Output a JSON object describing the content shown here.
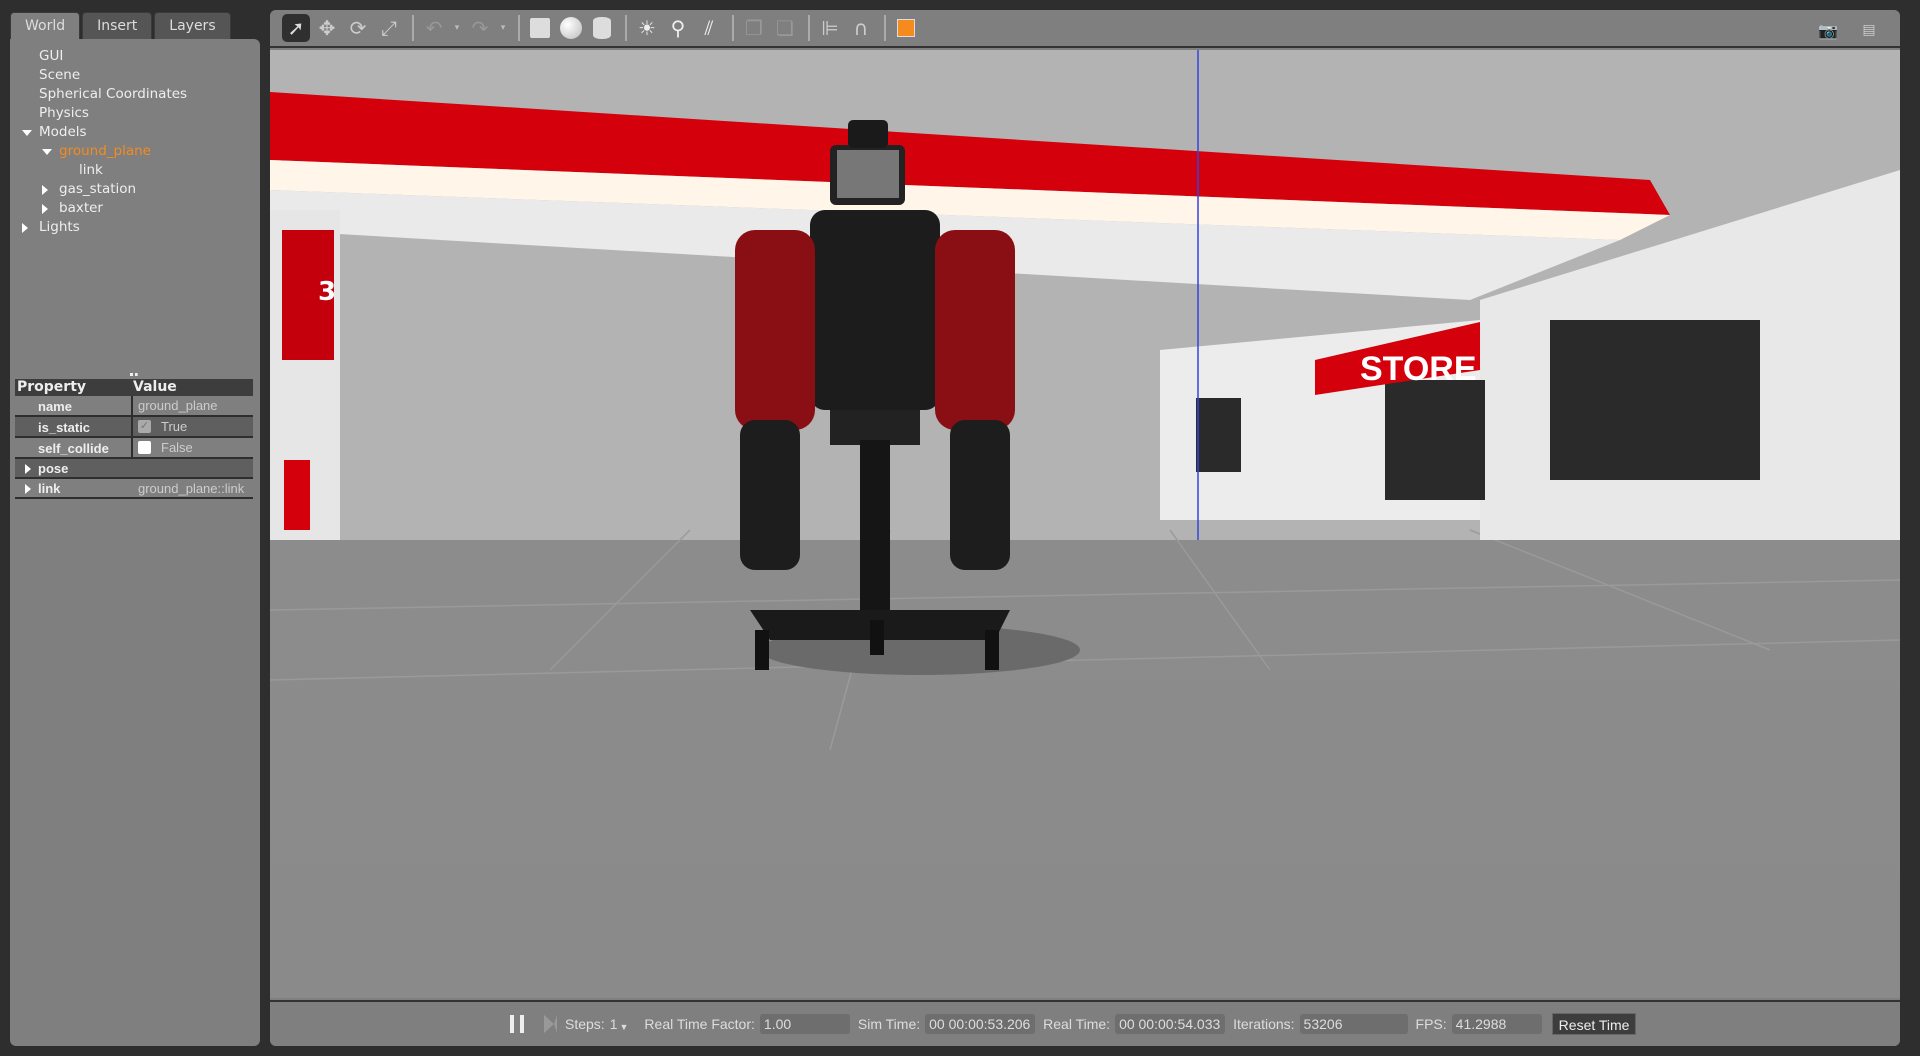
{
  "tabs": [
    "World",
    "Insert",
    "Layers"
  ],
  "tree": [
    {
      "label": "GUI",
      "level": 0,
      "arrow": "none"
    },
    {
      "label": "Scene",
      "level": 0,
      "arrow": "none"
    },
    {
      "label": "Spherical Coordinates",
      "level": 0,
      "arrow": "none"
    },
    {
      "label": "Physics",
      "level": 0,
      "arrow": "none"
    },
    {
      "label": "Models",
      "level": 0,
      "arrow": "down"
    },
    {
      "label": "ground_plane",
      "level": 1,
      "arrow": "down",
      "selected": true
    },
    {
      "label": "link",
      "level": 2,
      "arrow": "none"
    },
    {
      "label": "gas_station",
      "level": 1,
      "arrow": "right"
    },
    {
      "label": "baxter",
      "level": 1,
      "arrow": "right"
    },
    {
      "label": "Lights",
      "level": 0,
      "arrow": "right"
    }
  ],
  "properties": {
    "header": {
      "property": "Property",
      "value": "Value"
    },
    "rows": [
      {
        "key": "name",
        "value": "ground_plane"
      },
      {
        "key": "is_static",
        "value": "True",
        "checked": true
      },
      {
        "key": "self_collide",
        "value": "False",
        "checked": false
      }
    ],
    "groups": [
      {
        "key": "pose",
        "value": ""
      },
      {
        "key": "link",
        "value": "ground_plane::link"
      }
    ]
  },
  "toolbar": {
    "icons": [
      "select-arrow",
      "translate",
      "rotate",
      "scale",
      "undo",
      "redo",
      "box",
      "sphere",
      "cylinder",
      "point-light",
      "spot-light",
      "directional-light",
      "copy",
      "paste",
      "align",
      "snap",
      "view-angle"
    ],
    "selected": "select-arrow"
  },
  "bottom": {
    "steps_label": "Steps:",
    "steps_value": "1",
    "rtf_label": "Real Time Factor:",
    "rtf_value": "1.00",
    "sim_label": "Sim Time:",
    "sim_value": "00 00:00:53.206",
    "real_label": "Real Time:",
    "real_value": "00 00:00:54.033",
    "iter_label": "Iterations:",
    "iter_value": "53206",
    "fps_label": "FPS:",
    "fps_value": "41.2988",
    "reset_label": "Reset Time"
  },
  "scene": {
    "sign": "STORE",
    "pump_number": "3"
  },
  "colors": {
    "selected": "#f58a1f",
    "canopy": "#d4000c",
    "panel": "#7f7f7f"
  }
}
